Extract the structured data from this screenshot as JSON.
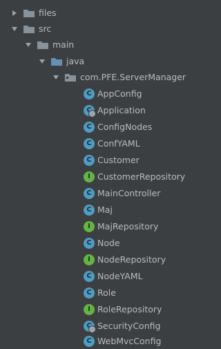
{
  "tree": {
    "folders": [
      {
        "label": "files",
        "state": "collapsed"
      },
      {
        "label": "src",
        "state": "expanded"
      },
      {
        "label": "main",
        "state": "expanded"
      },
      {
        "label": "java",
        "state": "expanded"
      },
      {
        "label": "com.PFE.ServerManager",
        "state": "expanded"
      }
    ],
    "items": [
      {
        "label": "AppConfig",
        "kind": "class",
        "glyph": "C"
      },
      {
        "label": "Application",
        "kind": "class-runnable",
        "glyph": "C"
      },
      {
        "label": "ConfigNodes",
        "kind": "class",
        "glyph": "C"
      },
      {
        "label": "ConfYAML",
        "kind": "class",
        "glyph": "C"
      },
      {
        "label": "Customer",
        "kind": "class",
        "glyph": "C"
      },
      {
        "label": "CustomerRepository",
        "kind": "interface",
        "glyph": "I"
      },
      {
        "label": "MainController",
        "kind": "class",
        "glyph": "C"
      },
      {
        "label": "Maj",
        "kind": "class",
        "glyph": "C"
      },
      {
        "label": "MajRepository",
        "kind": "interface",
        "glyph": "I"
      },
      {
        "label": "Node",
        "kind": "class",
        "glyph": "C"
      },
      {
        "label": "NodeRepository",
        "kind": "interface",
        "glyph": "I"
      },
      {
        "label": "NodeYAML",
        "kind": "class",
        "glyph": "C"
      },
      {
        "label": "Role",
        "kind": "class",
        "glyph": "C"
      },
      {
        "label": "RoleRepository",
        "kind": "interface",
        "glyph": "I"
      },
      {
        "label": "SecurityConfig",
        "kind": "class-config",
        "glyph": "C"
      },
      {
        "label": "WebMvcConfig",
        "kind": "class",
        "glyph": "C"
      }
    ]
  },
  "colors": {
    "background": "#3c3f41",
    "text": "#bbbbbb",
    "class_icon": "#4d9dc4",
    "interface_icon": "#62b543",
    "folder": "#87939a",
    "package": "#87939a"
  }
}
